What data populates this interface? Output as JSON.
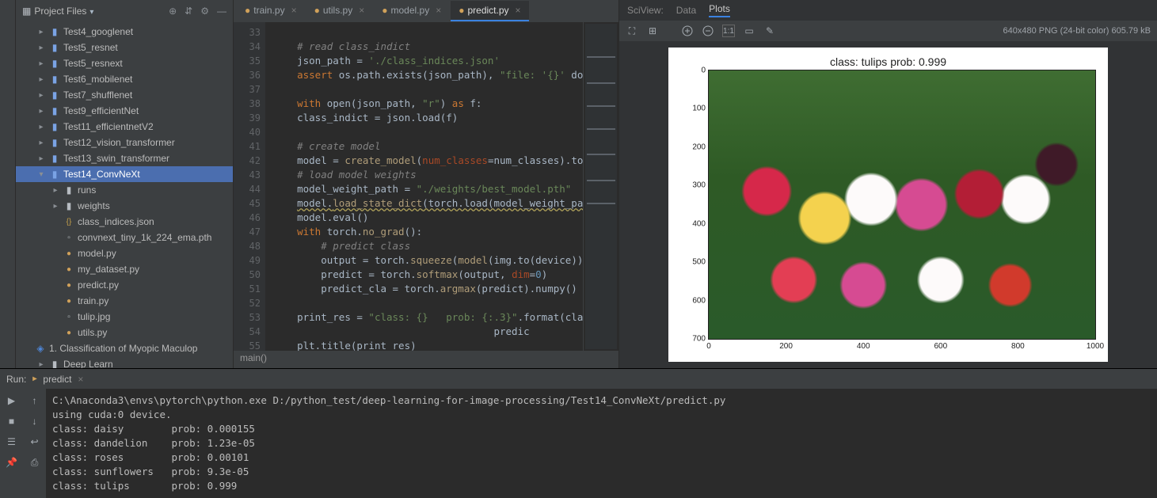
{
  "sidebar": {
    "title": "Project Files",
    "items": [
      {
        "indent": 1,
        "icon": "folder-blue",
        "arrow": "right",
        "label": "Test4_googlenet"
      },
      {
        "indent": 1,
        "icon": "folder-blue",
        "arrow": "right",
        "label": "Test5_resnet"
      },
      {
        "indent": 1,
        "icon": "folder-blue",
        "arrow": "right",
        "label": "Test5_resnext"
      },
      {
        "indent": 1,
        "icon": "folder-blue",
        "arrow": "right",
        "label": "Test6_mobilenet"
      },
      {
        "indent": 1,
        "icon": "folder-blue",
        "arrow": "right",
        "label": "Test7_shufflenet"
      },
      {
        "indent": 1,
        "icon": "folder-blue",
        "arrow": "right",
        "label": "Test9_efficientNet"
      },
      {
        "indent": 1,
        "icon": "folder-blue",
        "arrow": "right",
        "label": "Test11_efficientnetV2"
      },
      {
        "indent": 1,
        "icon": "folder-blue",
        "arrow": "right",
        "label": "Test12_vision_transformer"
      },
      {
        "indent": 1,
        "icon": "folder-blue",
        "arrow": "right",
        "label": "Test13_swin_transformer"
      },
      {
        "indent": 1,
        "icon": "folder-blue",
        "arrow": "down",
        "label": "Test14_ConvNeXt",
        "selected": true
      },
      {
        "indent": 2,
        "icon": "folder",
        "arrow": "right",
        "label": "runs"
      },
      {
        "indent": 2,
        "icon": "folder",
        "arrow": "right",
        "label": "weights"
      },
      {
        "indent": 2,
        "icon": "json",
        "arrow": "",
        "label": "class_indices.json"
      },
      {
        "indent": 2,
        "icon": "file",
        "arrow": "",
        "label": "convnext_tiny_1k_224_ema.pth"
      },
      {
        "indent": 2,
        "icon": "py",
        "arrow": "",
        "label": "model.py"
      },
      {
        "indent": 2,
        "icon": "py",
        "arrow": "",
        "label": "my_dataset.py"
      },
      {
        "indent": 2,
        "icon": "py",
        "arrow": "",
        "label": "predict.py"
      },
      {
        "indent": 2,
        "icon": "py",
        "arrow": "",
        "label": "train.py"
      },
      {
        "indent": 2,
        "icon": "file",
        "arrow": "",
        "label": "tulip.jpg"
      },
      {
        "indent": 2,
        "icon": "py",
        "arrow": "",
        "label": "utils.py"
      },
      {
        "indent": 0,
        "icon": "bookmark",
        "arrow": "",
        "label": "1. Classification of Myopic Maculop"
      },
      {
        "indent": 1,
        "icon": "folder",
        "arrow": "right",
        "label": "Deep Learn"
      }
    ]
  },
  "editor": {
    "tabs": [
      {
        "label": "train.py"
      },
      {
        "label": "utils.py"
      },
      {
        "label": "model.py"
      },
      {
        "label": "predict.py",
        "active": true
      }
    ],
    "line_numbers": [
      "33",
      "34",
      "35",
      "36",
      "37",
      "38",
      "39",
      "40",
      "41",
      "42",
      "43",
      "44",
      "45",
      "46",
      "47",
      "48",
      "49",
      "50",
      "51",
      "52",
      "53",
      "54",
      "55"
    ],
    "breadcrumb": "main()"
  },
  "code": {
    "l34_com": "# read class_indict",
    "l35_a": "json_path = ",
    "l35_b": "'./class_indices.json'",
    "l36_a": "assert",
    "l36_b": " os.path.exists(json_path), ",
    "l36_c": "\"file: '{}' ",
    "l36_d": "dose…",
    "l38_a": "with",
    "l38_b": " open(json_path, ",
    "l38_c": "\"r\"",
    "l38_d": ") ",
    "l38_e": "as",
    "l38_f": " f:",
    "l39": "    class_indict = json.load(f)",
    "l41_com": "# create model",
    "l42_a": "model = ",
    "l42_b": "create_model",
    "l42_c": "(",
    "l42_d": "num_classes",
    "l42_e": "=num_classes).to(de",
    "l43_com": "# load model weights",
    "l44_a": "model_weight_path = ",
    "l44_b": "\"./weights/best_model.pth\"",
    "l45_a": "model.",
    "l45_b": "load_state_dict",
    "l45_c": "(torch.load(model_weight_path,",
    "l46": "model.eval()",
    "l47_a": "with",
    "l47_b": " torch.",
    "l47_c": "no_grad",
    "l47_d": "():",
    "l48_com": "# predict class",
    "l49_a": "output = torch.",
    "l49_b": "squeeze",
    "l49_c": "(",
    "l49_d": "model",
    "l49_e": "(img.to(device))).c",
    "l50_a": "predict = torch.",
    "l50_b": "softmax",
    "l50_c": "(output, ",
    "l50_d": "dim",
    "l50_e": "=",
    "l50_f": "0",
    "l50_g": ")",
    "l51_a": "predict_cla = torch.",
    "l51_b": "argmax",
    "l51_c": "(predict).numpy()",
    "l53_a": "print_res = ",
    "l53_b": "\"class: {}   prob: {:.3}\"",
    "l53_c": ".format(class_",
    "l54": "                                     predic",
    "l55": "plt.title(print_res)"
  },
  "sciview": {
    "label": "SciView:",
    "tab_data": "Data",
    "tab_plots": "Plots",
    "meta": "640x480 PNG (24-bit color) 605.79 kB",
    "ratio": "1:1"
  },
  "chart_data": {
    "type": "image-plot",
    "title": "class: tulips   prob: 0.999",
    "xlim": [
      0,
      1000
    ],
    "ylim": [
      0,
      700
    ],
    "xticks": [
      0,
      200,
      400,
      600,
      800,
      1000
    ],
    "yticks": [
      0,
      100,
      200,
      300,
      400,
      500,
      600,
      700
    ],
    "y_inverted": true,
    "image_description": "photograph of multicolored tulips (red, pink, white, yellow, dark purple) over green foliage"
  },
  "run": {
    "label": "Run:",
    "config": "predict",
    "console": [
      "C:\\Anaconda3\\envs\\pytorch\\python.exe D:/python_test/deep-learning-for-image-processing/Test14_ConvNeXt/predict.py",
      "using cuda:0 device.",
      "class: daisy        prob: 0.000155",
      "class: dandelion    prob: 1.23e-05",
      "class: roses        prob: 0.00101",
      "class: sunflowers   prob: 9.3e-05",
      "class: tulips       prob: 0.999"
    ]
  }
}
